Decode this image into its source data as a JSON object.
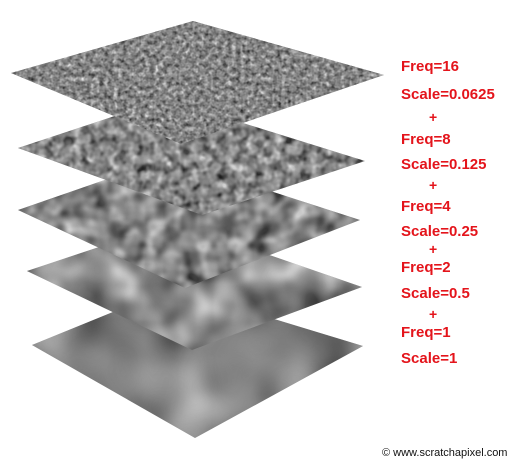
{
  "layers": [
    {
      "freq_label": "Freq=16",
      "scale_label": "Scale=0.0625",
      "freq": 16,
      "scale": 0.0625
    },
    {
      "freq_label": "Freq=8",
      "scale_label": "Scale=0.125",
      "freq": 8,
      "scale": 0.125
    },
    {
      "freq_label": "Freq=4",
      "scale_label": "Scale=0.25",
      "freq": 4,
      "scale": 0.25
    },
    {
      "freq_label": "Freq=2",
      "scale_label": "Scale=0.5",
      "freq": 2,
      "scale": 0.5
    },
    {
      "freq_label": "Freq=1",
      "scale_label": "Scale=1",
      "freq": 1,
      "scale": 1
    }
  ],
  "plus_symbol": "+",
  "credit": "© www.scratchapixel.com",
  "colors": {
    "label": "#e4141b",
    "background": "#ffffff",
    "credit": "#111111"
  }
}
